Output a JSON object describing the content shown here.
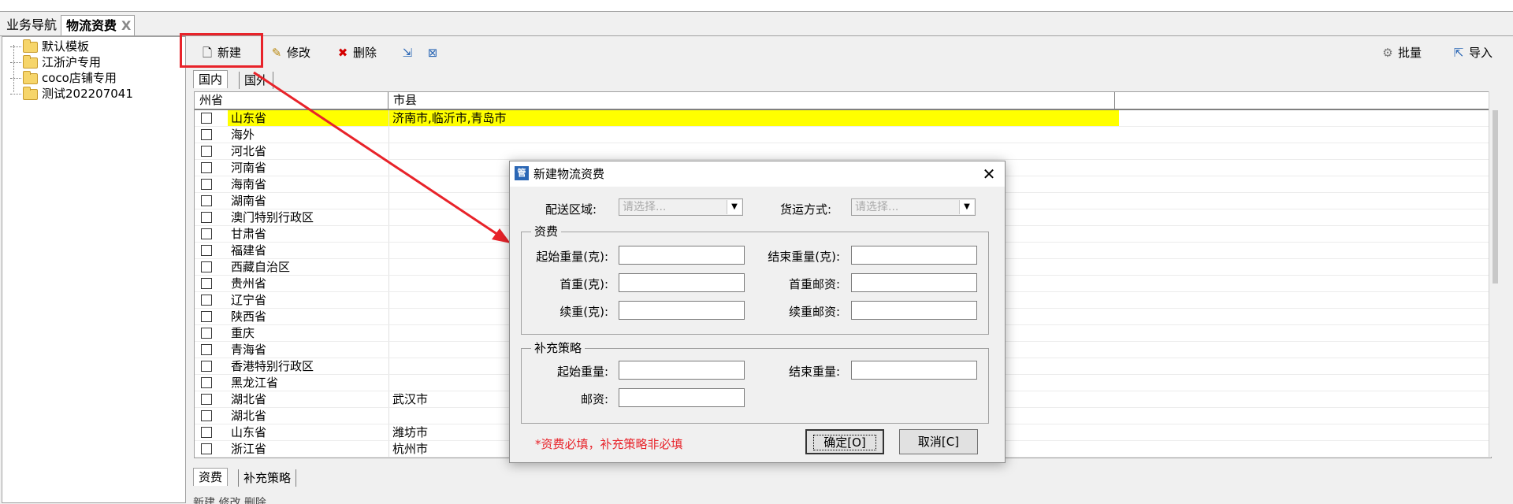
{
  "tabs": {
    "nav": "业务导航",
    "fee": "物流资费",
    "close": "X"
  },
  "tree": {
    "items": [
      "默认模板",
      "江浙沪专用",
      "coco店铺专用",
      "测试202207041"
    ]
  },
  "toolbar": {
    "new": "新建",
    "edit": "修改",
    "delete": "删除",
    "batch": "批量",
    "import": "导入"
  },
  "subtabs": {
    "domestic": "国内",
    "foreign": "国外"
  },
  "grid": {
    "headers": {
      "province": "州省",
      "city": "市县"
    },
    "rows": [
      {
        "province": "山东省",
        "city": "济南市,临沂市,青岛市",
        "highlight": true
      },
      {
        "province": "海外",
        "city": ""
      },
      {
        "province": "河北省",
        "city": ""
      },
      {
        "province": "河南省",
        "city": ""
      },
      {
        "province": "海南省",
        "city": ""
      },
      {
        "province": "湖南省",
        "city": ""
      },
      {
        "province": "澳门特别行政区",
        "city": ""
      },
      {
        "province": "甘肃省",
        "city": ""
      },
      {
        "province": "福建省",
        "city": ""
      },
      {
        "province": "西藏自治区",
        "city": ""
      },
      {
        "province": "贵州省",
        "city": ""
      },
      {
        "province": "辽宁省",
        "city": ""
      },
      {
        "province": "陕西省",
        "city": ""
      },
      {
        "province": "重庆",
        "city": ""
      },
      {
        "province": "青海省",
        "city": ""
      },
      {
        "province": "香港特别行政区",
        "city": ""
      },
      {
        "province": "黑龙江省",
        "city": ""
      },
      {
        "province": "湖北省",
        "city": "武汉市"
      },
      {
        "province": "湖北省",
        "city": ""
      },
      {
        "province": "山东省",
        "city": "潍坊市"
      },
      {
        "province": "浙江省",
        "city": "杭州市"
      }
    ]
  },
  "bottom_tabs": {
    "fee": "资费",
    "supplement": "补充策略"
  },
  "bottom_toolbar": "新建   修改   删除",
  "dialog": {
    "title": "新建物流资费",
    "close": "✕",
    "delivery_area": {
      "label": "配送区域:",
      "placeholder": "请选择..."
    },
    "shipping_method": {
      "label": "货运方式:",
      "placeholder": "请选择..."
    },
    "fee_group": {
      "title": "资费",
      "start_weight": "起始重量(克):",
      "end_weight": "结束重量(克):",
      "first_weight": "首重(克):",
      "first_postage": "首重邮资:",
      "cont_weight": "续重(克):",
      "cont_postage": "续重邮资:"
    },
    "sup_group": {
      "title": "补充策略",
      "start_weight": "起始重量:",
      "end_weight": "结束重量:",
      "postage": "邮资:"
    },
    "note": "*资费必填，补充策略非必填",
    "ok": "确定[O]",
    "cancel": "取消[C]"
  },
  "colors": {
    "highlight": "#ffff00",
    "annotation": "#e8232a"
  }
}
